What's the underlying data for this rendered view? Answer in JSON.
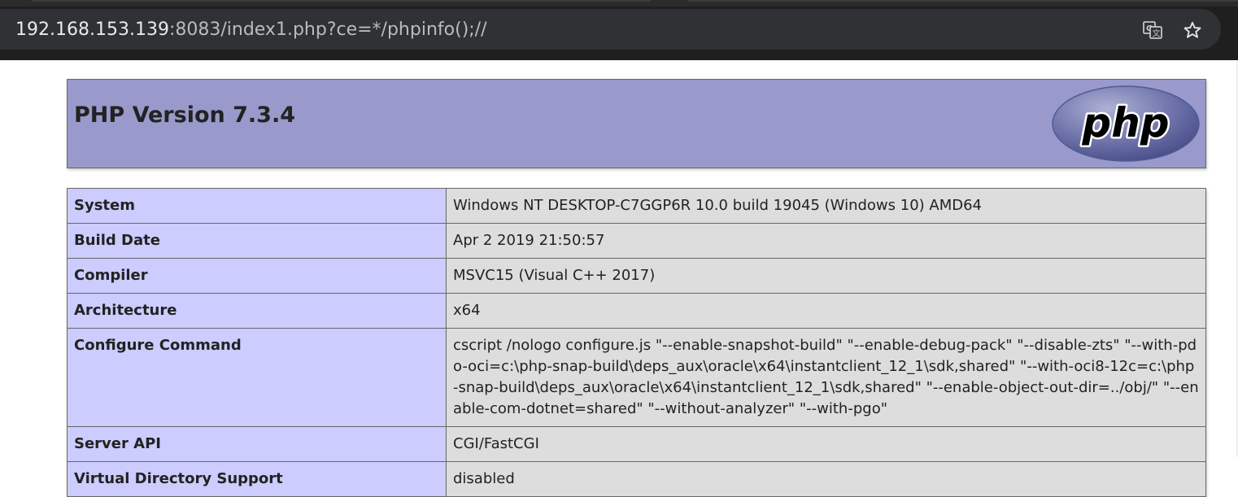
{
  "browser": {
    "url_host": "192.168.153.139",
    "url_rest": ":8083/index1.php?ce=*/phpinfo();//",
    "icons": [
      "translate-icon",
      "star-icon"
    ]
  },
  "header": {
    "title": "PHP Version 7.3.4",
    "logo_text": "php"
  },
  "table": {
    "rows": [
      {
        "key": "System",
        "value": "Windows NT DESKTOP-C7GGP6R 10.0 build 19045 (Windows 10) AMD64"
      },
      {
        "key": "Build Date",
        "value": "Apr 2 2019 21:50:57"
      },
      {
        "key": "Compiler",
        "value": "MSVC15 (Visual C++ 2017)"
      },
      {
        "key": "Architecture",
        "value": "x64"
      },
      {
        "key": "Configure Command",
        "value": "cscript /nologo configure.js \"--enable-snapshot-build\" \"--enable-debug-pack\" \"--disable-zts\" \"--with-pdo-oci=c:\\php-snap-build\\deps_aux\\oracle\\x64\\instantclient_12_1\\sdk,shared\" \"--with-oci8-12c=c:\\php-snap-build\\deps_aux\\oracle\\x64\\instantclient_12_1\\sdk,shared\" \"--enable-object-out-dir=../obj/\" \"--enable-com-dotnet=shared\" \"--without-analyzer\" \"--with-pgo\""
      },
      {
        "key": "Server API",
        "value": "CGI/FastCGI"
      },
      {
        "key": "Virtual Directory Support",
        "value": "disabled"
      }
    ]
  },
  "colors": {
    "header_bg": "#9999cc",
    "key_bg": "#ccccff",
    "value_bg": "#dddddd"
  }
}
